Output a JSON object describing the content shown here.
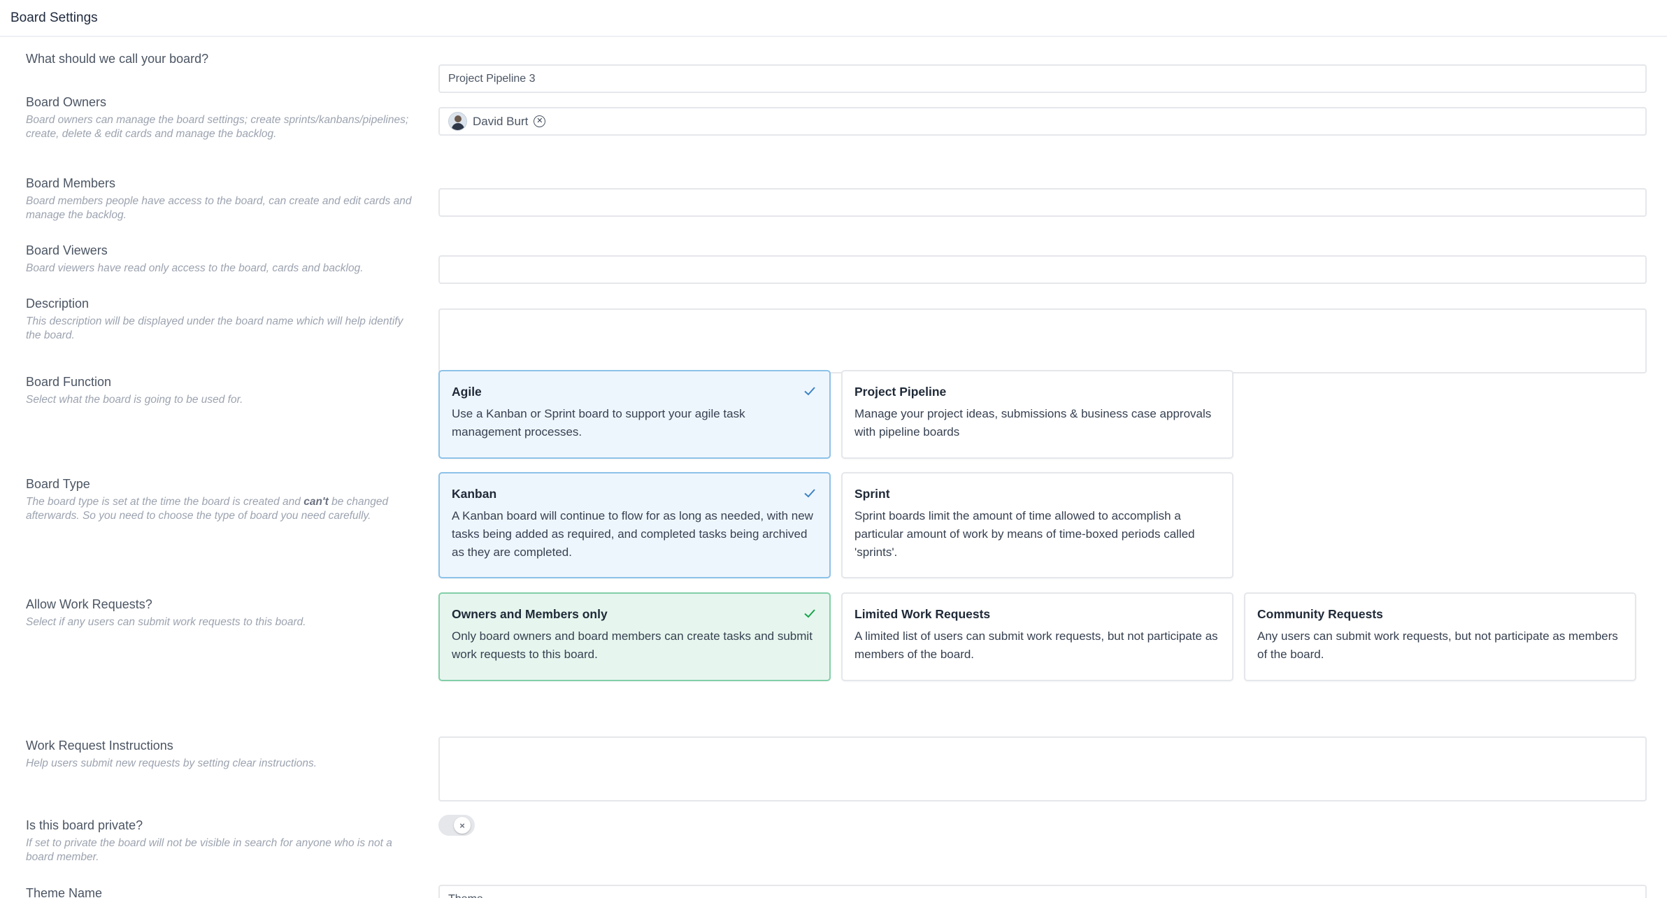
{
  "header": {
    "title": "Board Settings"
  },
  "fields": {
    "name": {
      "label": "What should we call your board?",
      "value": "Project Pipeline 3"
    },
    "owners": {
      "label": "Board Owners",
      "help": "Board owners can manage the board settings; create sprints/kanbans/pipelines; create, delete & edit cards and manage the backlog.",
      "chip_name": "David Burt"
    },
    "members": {
      "label": "Board Members",
      "help": "Board members people have access to the board, can create and edit cards and manage the backlog."
    },
    "viewers": {
      "label": "Board Viewers",
      "help": "Board viewers have read only access to the board, cards and backlog."
    },
    "description": {
      "label": "Description",
      "help": "This description will be displayed under the board name which will help identify the board."
    },
    "function": {
      "label": "Board Function",
      "help": "Select what the board is going to be used for.",
      "options": [
        {
          "title": "Agile",
          "desc": "Use a Kanban or Sprint board to support your agile task management processes.",
          "selected": true
        },
        {
          "title": "Project Pipeline",
          "desc": "Manage your project ideas, submissions & business case approvals with pipeline boards",
          "selected": false
        }
      ]
    },
    "type": {
      "label": "Board Type",
      "help_pre": "The board type is set at the time the board is created and ",
      "help_bold": "can't",
      "help_post": " be changed afterwards. So you need to choose the type of board you need carefully.",
      "options": [
        {
          "title": "Kanban",
          "desc": "A Kanban board will continue to flow for as long as needed, with new tasks being added as required, and completed tasks being archived as they are completed.",
          "selected": true
        },
        {
          "title": "Sprint",
          "desc": "Sprint boards limit the amount of time allowed to accomplish a particular amount of work by means of time-boxed periods called 'sprints'.",
          "selected": false
        }
      ]
    },
    "work_requests": {
      "label": "Allow Work Requests?",
      "help": "Select if any users can submit work requests to this board.",
      "options": [
        {
          "title": "Owners and Members only",
          "desc": "Only board owners and board members can create tasks and submit work requests to this board.",
          "selected": true
        },
        {
          "title": "Limited Work Requests",
          "desc": "A limited list of users can submit work requests, but not participate as members of the board.",
          "selected": false
        },
        {
          "title": "Community Requests",
          "desc": "Any users can submit work requests, but not participate as members of the board.",
          "selected": false
        }
      ]
    },
    "instructions": {
      "label": "Work Request Instructions",
      "help": "Help users submit new requests by setting clear instructions."
    },
    "private": {
      "label": "Is this board private?",
      "help": "If set to private the board will not be visible in search for anyone who is not a board member.",
      "enabled": false,
      "knob_glyph": "×"
    },
    "theme": {
      "label": "Theme Name",
      "placeholder": "Theme"
    }
  },
  "colors": {
    "selected_blue_bg": "#eef6fd",
    "selected_blue_border": "#8cc2e8",
    "selected_green_bg": "#e6f6ee",
    "selected_green_border": "#83cfa8",
    "check_blue": "#3b82c4",
    "check_green": "#16a34a"
  },
  "icons": {
    "check": "checkmark-icon",
    "remove": "circle-x-icon",
    "avatar": "user-avatar"
  }
}
